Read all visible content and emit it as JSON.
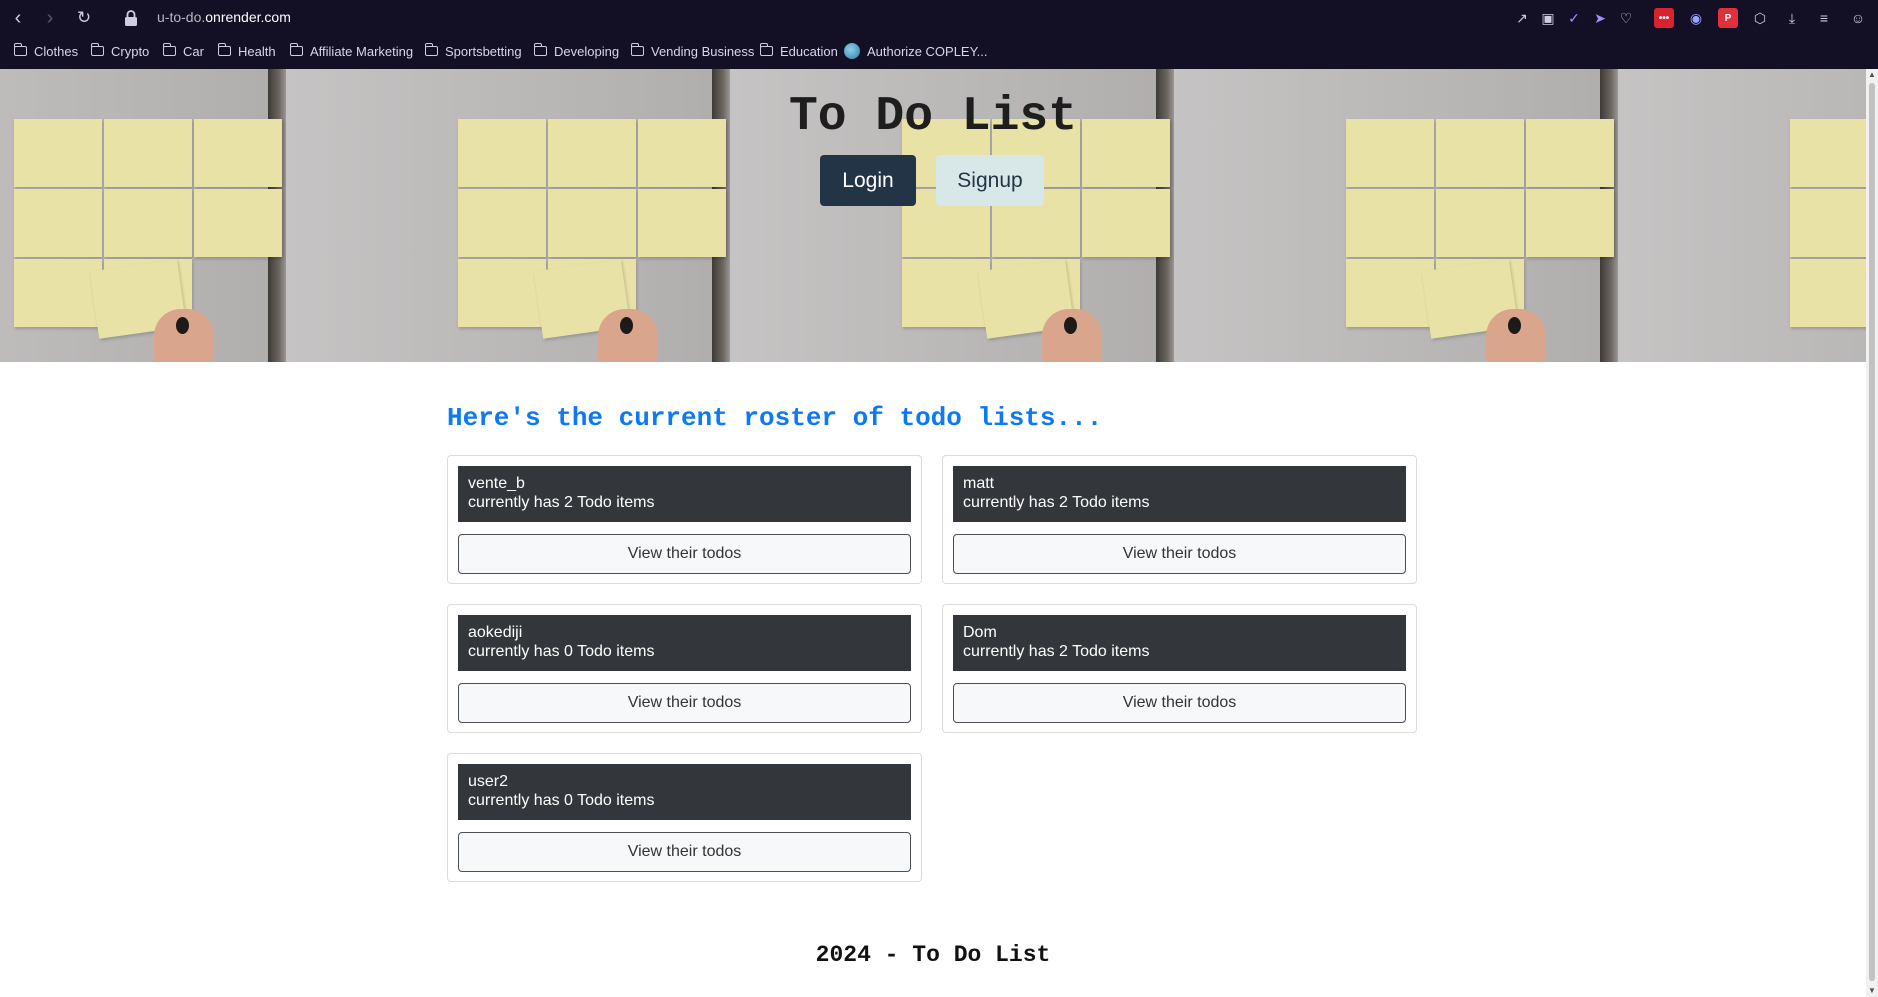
{
  "browser": {
    "url_prefix": "u-to-do.",
    "url_domain": "onrender.com",
    "bookmarks": [
      {
        "label": "Clothes",
        "icon": "folder-icon"
      },
      {
        "label": "Crypto",
        "icon": "folder-icon"
      },
      {
        "label": "Car",
        "icon": "folder-icon"
      },
      {
        "label": "Health",
        "icon": "folder-icon"
      },
      {
        "label": "Affiliate Marketing",
        "icon": "folder-icon"
      },
      {
        "label": "Sportsbetting",
        "icon": "folder-icon"
      },
      {
        "label": "Developing",
        "icon": "folder-icon"
      },
      {
        "label": "Vending Business",
        "icon": "folder-icon"
      },
      {
        "label": "Education",
        "icon": "folder-icon"
      },
      {
        "label": "Authorize COPLEY...",
        "icon": "globe-icon"
      }
    ]
  },
  "hero": {
    "title": "To Do List",
    "login_label": "Login",
    "signup_label": "Signup"
  },
  "roster": {
    "heading": "Here's the current roster of todo lists...",
    "users": [
      {
        "name": "vente_b",
        "summary": "currently has 2 Todo items",
        "button_label": "View their todos"
      },
      {
        "name": "matt",
        "summary": "currently has 2 Todo items",
        "button_label": "View their todos"
      },
      {
        "name": "aokediji",
        "summary": "currently has 0 Todo items",
        "button_label": "View their todos"
      },
      {
        "name": "Dom",
        "summary": "currently has 2 Todo items",
        "button_label": "View their todos"
      },
      {
        "name": "user2",
        "summary": "currently has 0 Todo items",
        "button_label": "View their todos"
      }
    ]
  },
  "footer": {
    "text": "2024 - To Do List"
  },
  "colors": {
    "browser_bg": "#130f24",
    "heading_blue": "#0d79f2",
    "login_bg": "#243447",
    "signup_bg": "#d8e7e8",
    "card_header_bg": "#33373b"
  }
}
